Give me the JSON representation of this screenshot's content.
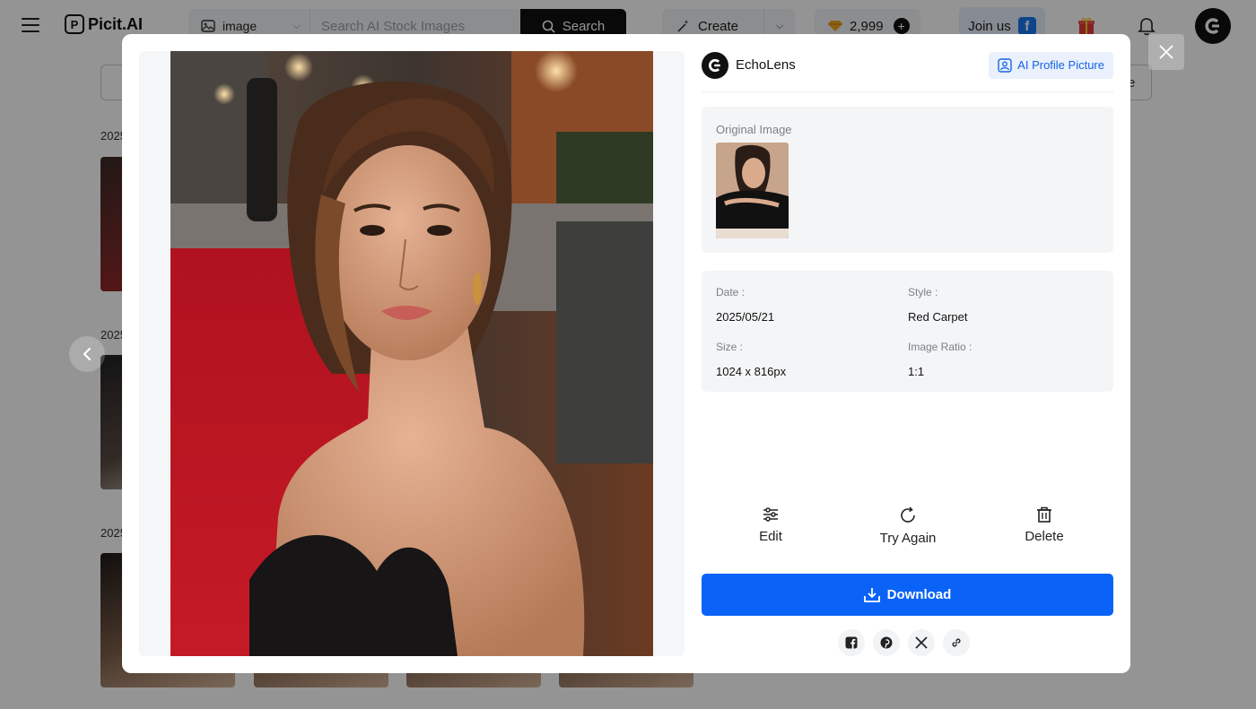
{
  "header": {
    "logo_text": "Picit.AI",
    "search": {
      "type_label": "image",
      "placeholder": "Search AI Stock Images",
      "button_label": "Search"
    },
    "create_label": "Create",
    "credits": "2,999",
    "join_label": "Join us"
  },
  "background": {
    "dates": [
      "2025",
      "2025",
      "2025"
    ],
    "filter_right_text": "e"
  },
  "modal": {
    "author": "EchoLens",
    "tag_label": "AI Profile Picture",
    "original_image_label": "Original Image",
    "meta": {
      "date_label": "Date :",
      "date_value": "2025/05/21",
      "style_label": "Style :",
      "style_value": "Red Carpet",
      "size_label": "Size :",
      "size_value": "1024 x 816px",
      "ratio_label": "Image Ratio :",
      "ratio_value": "1:1"
    },
    "actions": {
      "edit": "Edit",
      "try_again": "Try Again",
      "delete": "Delete"
    },
    "download_label": "Download",
    "share_icons": [
      "facebook-icon",
      "pinterest-icon",
      "x-icon",
      "link-icon"
    ]
  },
  "colors": {
    "accent": "#0a63f6",
    "tag_bg": "#eaf1fc",
    "tag_text": "#1763e6",
    "overlay": "rgba(0,0,0,0.42)"
  }
}
